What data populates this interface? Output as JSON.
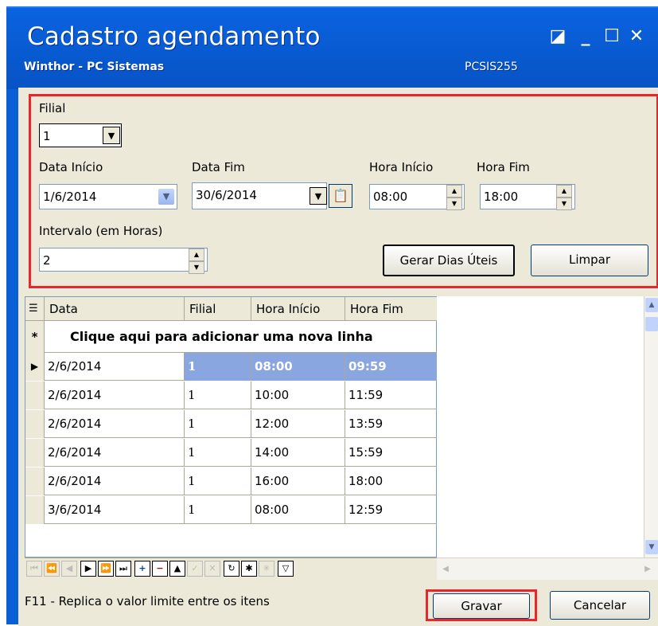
{
  "window": {
    "title": "Cadastro agendamento",
    "subtitle": "Winthor - PC Sistemas",
    "code": "PCSIS255"
  },
  "form": {
    "filial_label": "Filial",
    "filial_value": "1",
    "data_inicio_label": "Data Início",
    "data_inicio_value": "1/6/2014",
    "data_fim_label": "Data Fim",
    "data_fim_value": "30/6/2014",
    "hora_inicio_label": "Hora Início",
    "hora_inicio_value": "08:00",
    "hora_fim_label": "Hora Fim",
    "hora_fim_value": "18:00",
    "intervalo_label": "Intervalo (em Horas)",
    "intervalo_value": "2",
    "gerar_button": "Gerar Dias Úteis",
    "limpar_button": "Limpar"
  },
  "grid": {
    "columns": [
      "Data",
      "Filial",
      "Hora Início",
      "Hora Fim"
    ],
    "new_row_text": "Clique aqui para adicionar uma nova linha",
    "rows": [
      {
        "data": "2/6/2014",
        "filial": "1",
        "hora_inicio": "08:00",
        "hora_fim": "09:59",
        "selected": true
      },
      {
        "data": "2/6/2014",
        "filial": "1",
        "hora_inicio": "10:00",
        "hora_fim": "11:59"
      },
      {
        "data": "2/6/2014",
        "filial": "1",
        "hora_inicio": "12:00",
        "hora_fim": "13:59"
      },
      {
        "data": "2/6/2014",
        "filial": "1",
        "hora_inicio": "14:00",
        "hora_fim": "15:59"
      },
      {
        "data": "2/6/2014",
        "filial": "1",
        "hora_inicio": "16:00",
        "hora_fim": "18:00"
      },
      {
        "data": "3/6/2014",
        "filial": "1",
        "hora_inicio": "08:00",
        "hora_fim": "12:59"
      }
    ]
  },
  "footer": {
    "status": "F11 - Replica o valor limite entre os itens",
    "gravar_button": "Gravar",
    "cancelar_button": "Cancelar"
  }
}
